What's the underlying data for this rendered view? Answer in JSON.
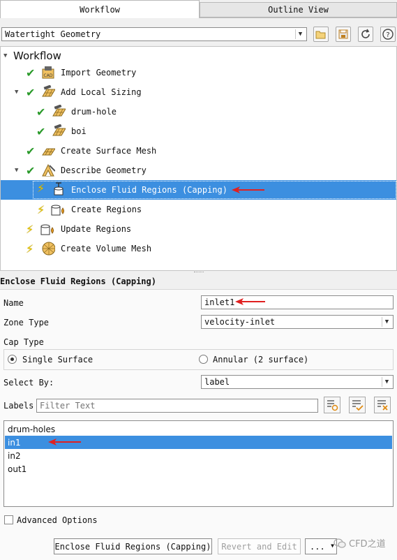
{
  "tabs": [
    {
      "label": "Workflow",
      "active": true
    },
    {
      "label": "Outline View",
      "active": false
    }
  ],
  "workflow_select": {
    "value": "Watertight Geometry"
  },
  "toolbar_icons": [
    "folder-open-icon",
    "save-icon",
    "refresh-icon",
    "help-icon"
  ],
  "tree": {
    "root": "Workflow",
    "items": [
      {
        "label": "Import Geometry",
        "status": "done"
      },
      {
        "label": "Add Local Sizing",
        "status": "done"
      },
      {
        "label": "drum-hole",
        "status": "done"
      },
      {
        "label": "boi",
        "status": "done"
      },
      {
        "label": "Create Surface Mesh",
        "status": "done"
      },
      {
        "label": "Describe Geometry",
        "status": "done"
      },
      {
        "label": "Enclose Fluid Regions (Capping)",
        "status": "pending",
        "selected": true
      },
      {
        "label": "Create Regions",
        "status": "pending"
      },
      {
        "label": "Update Regions",
        "status": "pending"
      },
      {
        "label": "Create Volume Mesh",
        "status": "pending"
      }
    ]
  },
  "panel": {
    "title": "Enclose Fluid Regions (Capping)",
    "name_label": "Name",
    "name_value": "inlet1",
    "zone_type_label": "Zone Type",
    "zone_type_value": "velocity-inlet",
    "cap_type_label": "Cap Type",
    "cap_single": "Single Surface",
    "cap_annular": "Annular (2 surface)",
    "select_by_label": "Select By:",
    "select_by_value": "label",
    "labels_label": "Labels",
    "filter_placeholder": "Filter Text",
    "list": [
      "drum-holes",
      "in1",
      "in2",
      "out1"
    ],
    "list_selected": 1,
    "advanced": "Advanced Options"
  },
  "buttons": {
    "primary": "Enclose Fluid Regions (Capping)",
    "revert": "Revert and Edit",
    "more": "..."
  },
  "watermark": "CFD之道",
  "colors": {
    "selection": "#3c8fe0",
    "check": "#2a9a2a",
    "bolt": "#e8c600",
    "arrow": "#e02020"
  }
}
